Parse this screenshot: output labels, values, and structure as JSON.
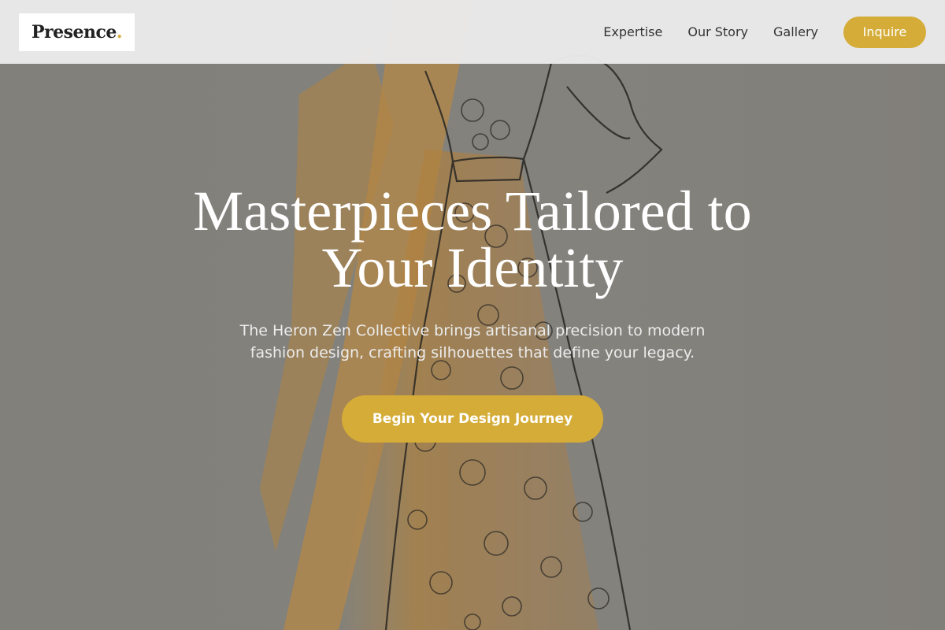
{
  "brand": {
    "name": "Presence",
    "dot": ".",
    "accent_color": "#d4ac37"
  },
  "nav": {
    "links": [
      "Expertise",
      "Our Story",
      "Gallery"
    ],
    "cta_label": "Inquire"
  },
  "hero": {
    "title": "Masterpieces Tailored to Your Identity",
    "subtitle": "The Heron Zen Collective brings artisanal precision to modern fashion design, crafting silhouettes that define your legacy.",
    "cta_label": "Begin Your Design Journey",
    "background": "fashion-sketch-illustration"
  }
}
